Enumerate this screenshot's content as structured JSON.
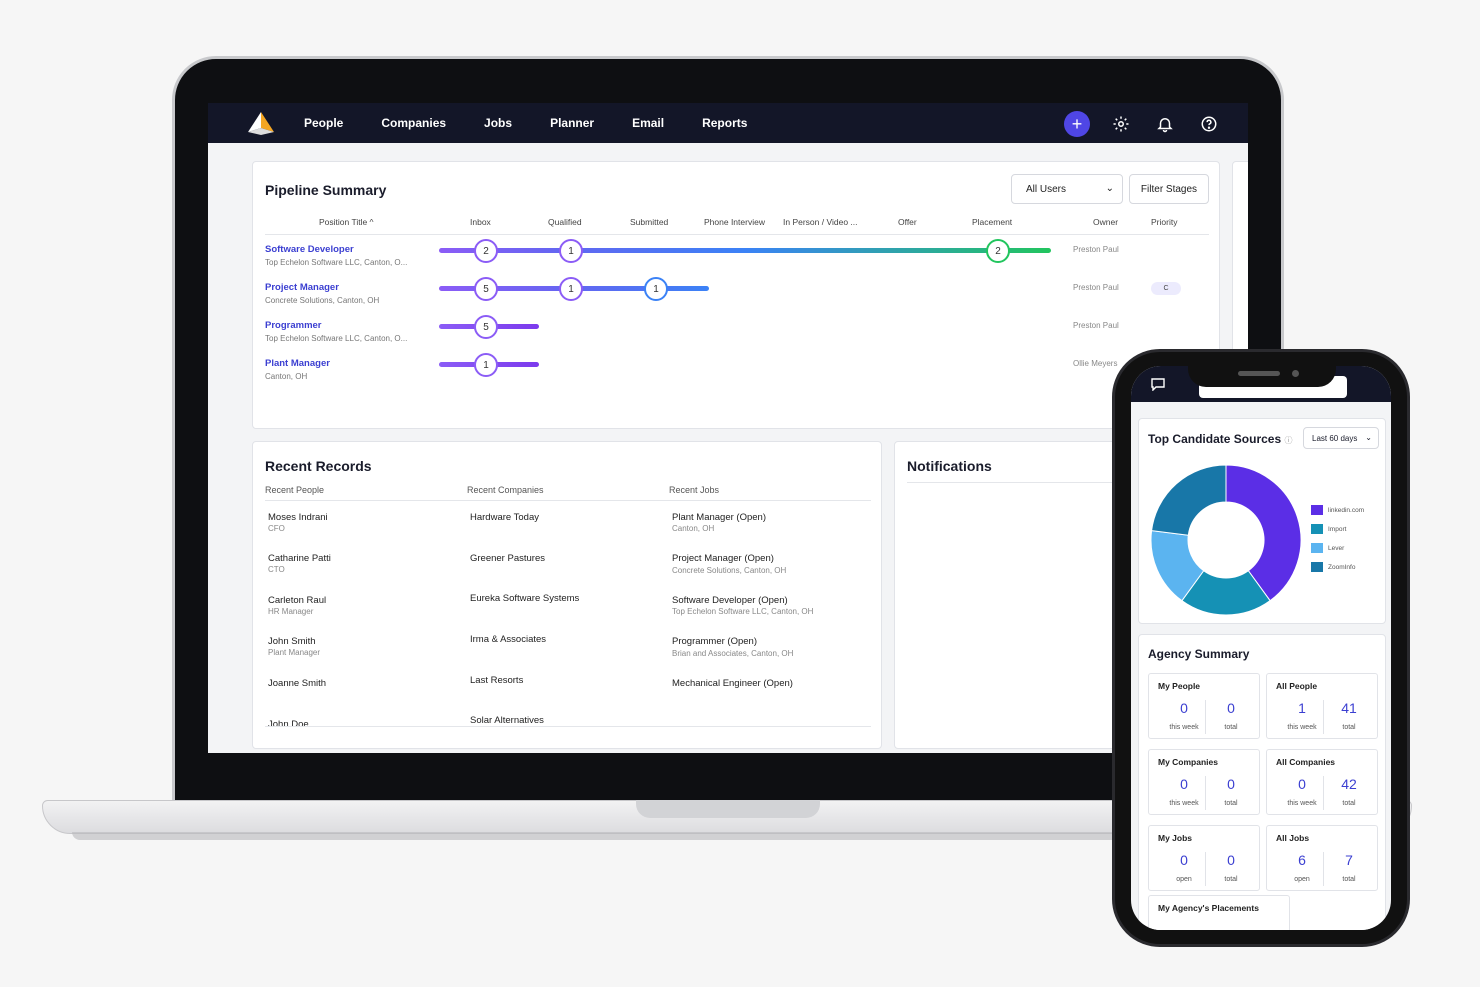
{
  "nav": {
    "items": [
      "People",
      "Companies",
      "Jobs",
      "Planner",
      "Email",
      "Reports"
    ],
    "plus_label": "+"
  },
  "pipeline": {
    "title": "Pipeline Summary",
    "user_filter": "All Users",
    "filter_button": "Filter Stages",
    "columns": [
      "Position Title ^",
      "Inbox",
      "Qualified",
      "Submitted",
      "Phone Interview",
      "In Person / Video ...",
      "Offer",
      "Placement",
      "Owner",
      "Priority"
    ],
    "rows": [
      {
        "title": "Software Developer",
        "sub": "Top Echelon Software LLC, Canton, O...",
        "owner": "Preston Paul",
        "priority": "",
        "counts": {
          "inbox": "2",
          "qualified": "1",
          "placement": "2"
        }
      },
      {
        "title": "Project Manager",
        "sub": "Concrete Solutions, Canton, OH",
        "owner": "Preston Paul",
        "priority": "C",
        "counts": {
          "inbox": "5",
          "qualified": "1",
          "submitted": "1"
        }
      },
      {
        "title": "Programmer",
        "sub": "Top Echelon Software LLC, Canton, O...",
        "owner": "Preston Paul",
        "priority": "",
        "counts": {
          "inbox": "5"
        }
      },
      {
        "title": "Plant Manager",
        "sub": "Canton, OH",
        "owner": "Ollie Meyers",
        "priority": "",
        "counts": {
          "inbox": "1"
        }
      }
    ]
  },
  "recent": {
    "title": "Recent Records",
    "headers": [
      "Recent People",
      "Recent Companies",
      "Recent Jobs"
    ],
    "people": [
      {
        "name": "Moses Indrani",
        "role": "CFO"
      },
      {
        "name": "Catharine Patti",
        "role": "CTO"
      },
      {
        "name": "Carleton Raul",
        "role": "HR Manager"
      },
      {
        "name": "John Smith",
        "role": "Plant Manager"
      },
      {
        "name": "Joanne Smith",
        "role": ""
      },
      {
        "name": "John Doe",
        "role": ""
      }
    ],
    "companies": [
      "Hardware Today",
      "Greener Pastures",
      "Eureka Software Systems",
      "Irma & Associates",
      "Last Resorts",
      "Solar Alternatives"
    ],
    "jobs": [
      {
        "name": "Plant Manager (Open)",
        "loc": "Canton, OH"
      },
      {
        "name": "Project Manager (Open)",
        "loc": "Concrete Solutions, Canton, OH"
      },
      {
        "name": "Software Developer (Open)",
        "loc": "Top Echelon Software LLC, Canton, OH"
      },
      {
        "name": "Programmer (Open)",
        "loc": "Brian and Associates, Canton, OH"
      },
      {
        "name": "Mechanical Engineer (Open)",
        "loc": ""
      }
    ]
  },
  "notifications": {
    "title": "Notifications"
  },
  "phone": {
    "sources": {
      "title": "Top Candidate Sources",
      "range": "Last 60 days",
      "chart_data": {
        "type": "pie",
        "categories": [
          "linkedin.com",
          "Import",
          "Lever",
          "ZoomInfo"
        ],
        "values": [
          40,
          20,
          17,
          23
        ],
        "colors": [
          "#5b2ee6",
          "#1591b5",
          "#5bb4f0",
          "#1877a8"
        ]
      }
    },
    "agency": {
      "title": "Agency Summary",
      "tiles": [
        {
          "title": "My People",
          "a": "0",
          "a_lbl": "this week",
          "b": "0",
          "b_lbl": "total"
        },
        {
          "title": "All People",
          "a": "1",
          "a_lbl": "this week",
          "b": "41",
          "b_lbl": "total"
        },
        {
          "title": "My Companies",
          "a": "0",
          "a_lbl": "this week",
          "b": "0",
          "b_lbl": "total"
        },
        {
          "title": "All Companies",
          "a": "0",
          "a_lbl": "this week",
          "b": "42",
          "b_lbl": "total"
        },
        {
          "title": "My Jobs",
          "a": "0",
          "a_lbl": "open",
          "b": "0",
          "b_lbl": "total"
        },
        {
          "title": "All Jobs",
          "a": "6",
          "a_lbl": "open",
          "b": "7",
          "b_lbl": "total"
        }
      ],
      "placements_title": "My Agency's Placements"
    }
  },
  "colors": {
    "nav_bg": "#131628",
    "accent": "#4f46e5",
    "link": "#3b3fd1"
  }
}
